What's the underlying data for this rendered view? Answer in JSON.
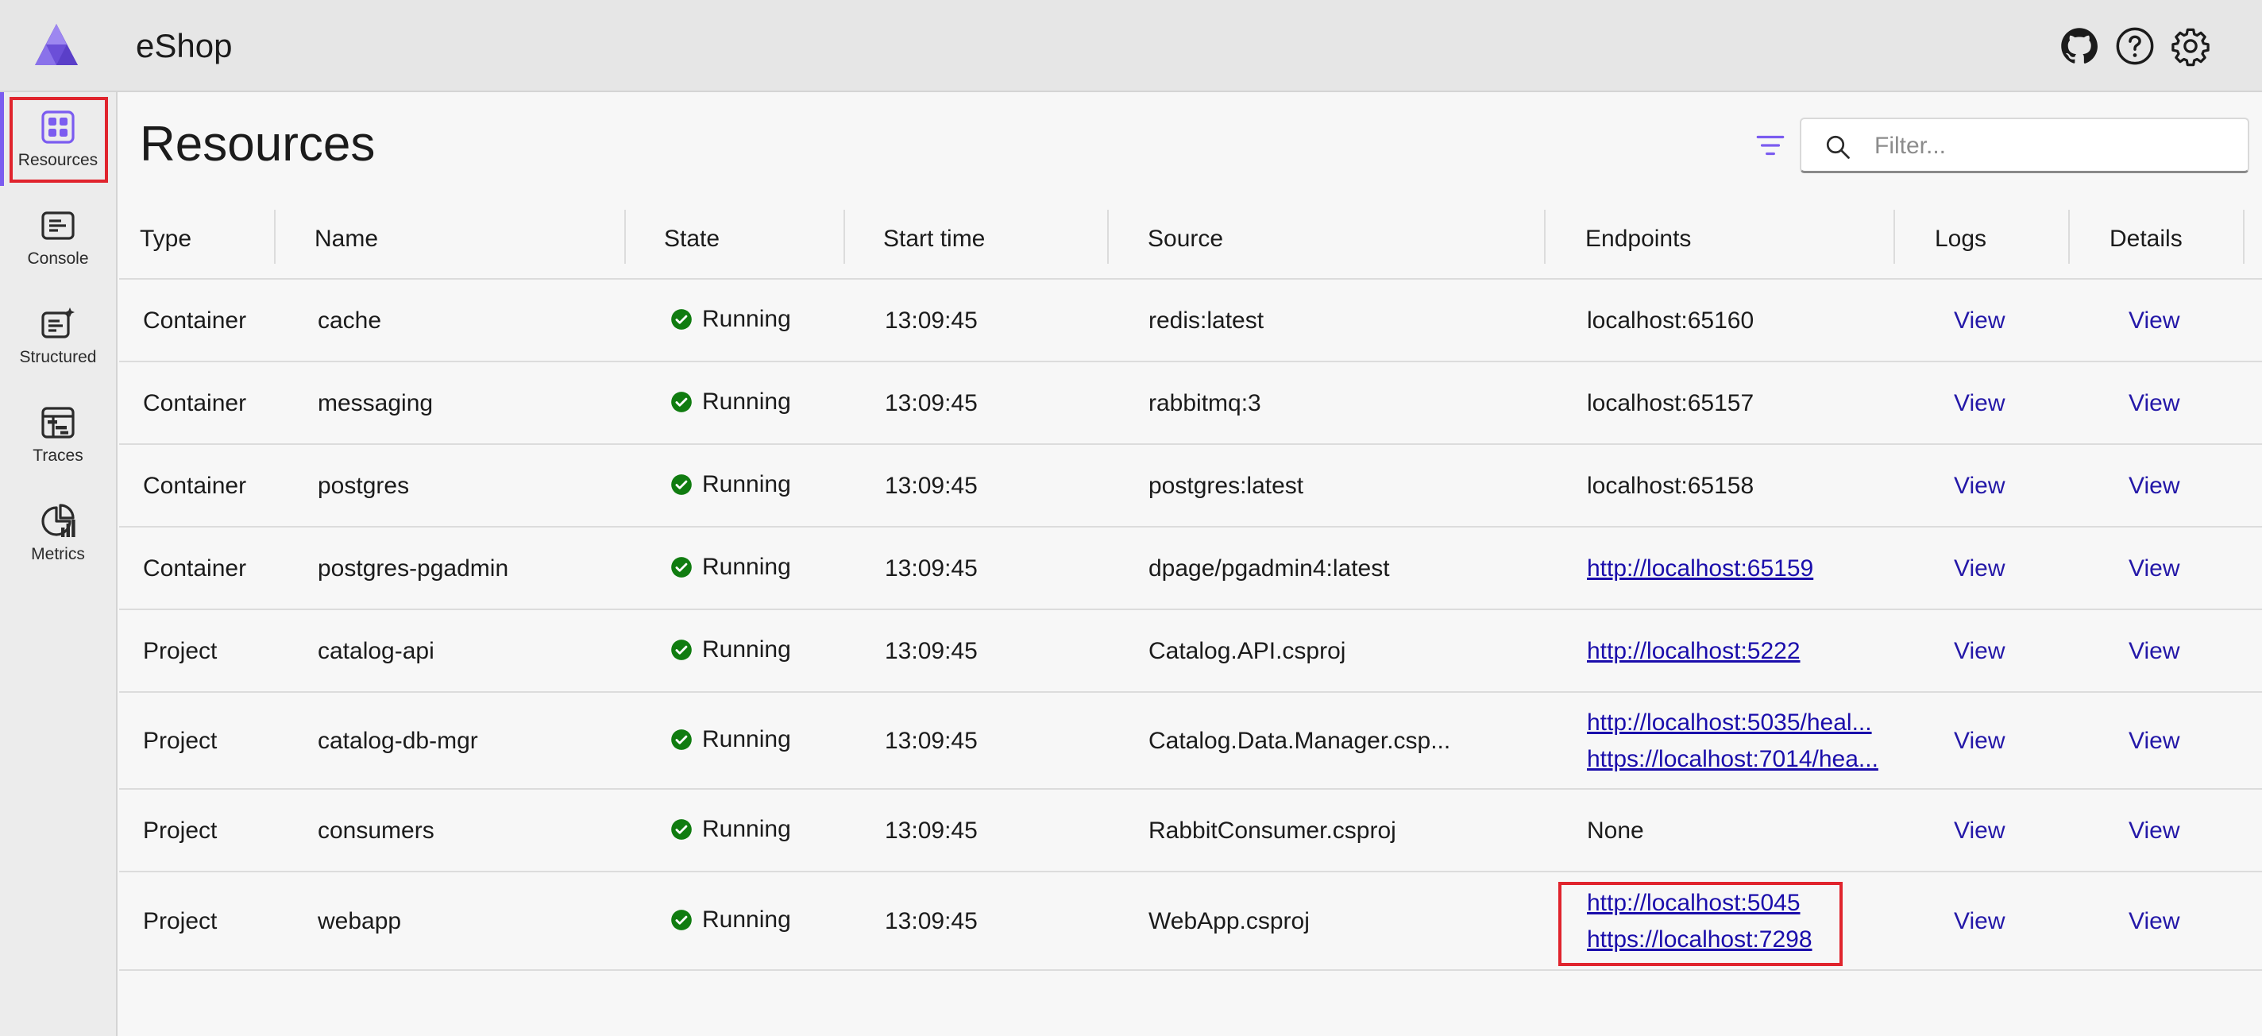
{
  "app": {
    "title": "eShop"
  },
  "sidebar": {
    "items": [
      {
        "label": "Resources",
        "icon": "resources-icon",
        "active": true
      },
      {
        "label": "Console",
        "icon": "console-icon"
      },
      {
        "label": "Structured",
        "icon": "structured-logs-icon"
      },
      {
        "label": "Traces",
        "icon": "traces-icon"
      },
      {
        "label": "Metrics",
        "icon": "metrics-icon"
      }
    ]
  },
  "header_icons": [
    "github-icon",
    "help-icon",
    "settings-icon"
  ],
  "page": {
    "title": "Resources"
  },
  "search": {
    "placeholder": "Filter...",
    "value": ""
  },
  "table": {
    "columns": [
      "Type",
      "Name",
      "State",
      "Start time",
      "Source",
      "Endpoints",
      "Logs",
      "Details"
    ],
    "rows": [
      {
        "type": "Container",
        "name": "cache",
        "state": "Running",
        "start": "13:09:45",
        "source": "redis:latest",
        "endpoints": [
          {
            "text": "localhost:65160",
            "link": false
          }
        ],
        "logs": "View",
        "details": "View"
      },
      {
        "type": "Container",
        "name": "messaging",
        "state": "Running",
        "start": "13:09:45",
        "source": "rabbitmq:3",
        "endpoints": [
          {
            "text": "localhost:65157",
            "link": false
          }
        ],
        "logs": "View",
        "details": "View"
      },
      {
        "type": "Container",
        "name": "postgres",
        "state": "Running",
        "start": "13:09:45",
        "source": "postgres:latest",
        "endpoints": [
          {
            "text": "localhost:65158",
            "link": false
          }
        ],
        "logs": "View",
        "details": "View"
      },
      {
        "type": "Container",
        "name": "postgres-pgadmin",
        "state": "Running",
        "start": "13:09:45",
        "source": "dpage/pgadmin4:latest",
        "endpoints": [
          {
            "text": "http://localhost:65159",
            "link": true
          }
        ],
        "logs": "View",
        "details": "View"
      },
      {
        "type": "Project",
        "name": "catalog-api",
        "state": "Running",
        "start": "13:09:45",
        "source": "Catalog.API.csproj",
        "endpoints": [
          {
            "text": "http://localhost:5222",
            "link": true
          }
        ],
        "logs": "View",
        "details": "View"
      },
      {
        "type": "Project",
        "name": "catalog-db-mgr",
        "state": "Running",
        "start": "13:09:45",
        "source": "Catalog.Data.Manager.csp...",
        "endpoints": [
          {
            "text": "http://localhost:5035/heal...",
            "link": true
          },
          {
            "text": "https://localhost:7014/hea...",
            "link": true
          }
        ],
        "logs": "View",
        "details": "View"
      },
      {
        "type": "Project",
        "name": "consumers",
        "state": "Running",
        "start": "13:09:45",
        "source": "RabbitConsumer.csproj",
        "endpoints": [
          {
            "text": "None",
            "link": false
          }
        ],
        "logs": "View",
        "details": "View"
      },
      {
        "type": "Project",
        "name": "webapp",
        "state": "Running",
        "start": "13:09:45",
        "source": "WebApp.csproj",
        "endpoints": [
          {
            "text": "http://localhost:5045",
            "link": true
          },
          {
            "text": "https://localhost:7298",
            "link": true
          }
        ],
        "logs": "View",
        "details": "View"
      }
    ]
  },
  "colors": {
    "accent": "#7b5cf0",
    "running": "#107c10",
    "link": "#1a0dab",
    "highlight": "#e0242d"
  }
}
